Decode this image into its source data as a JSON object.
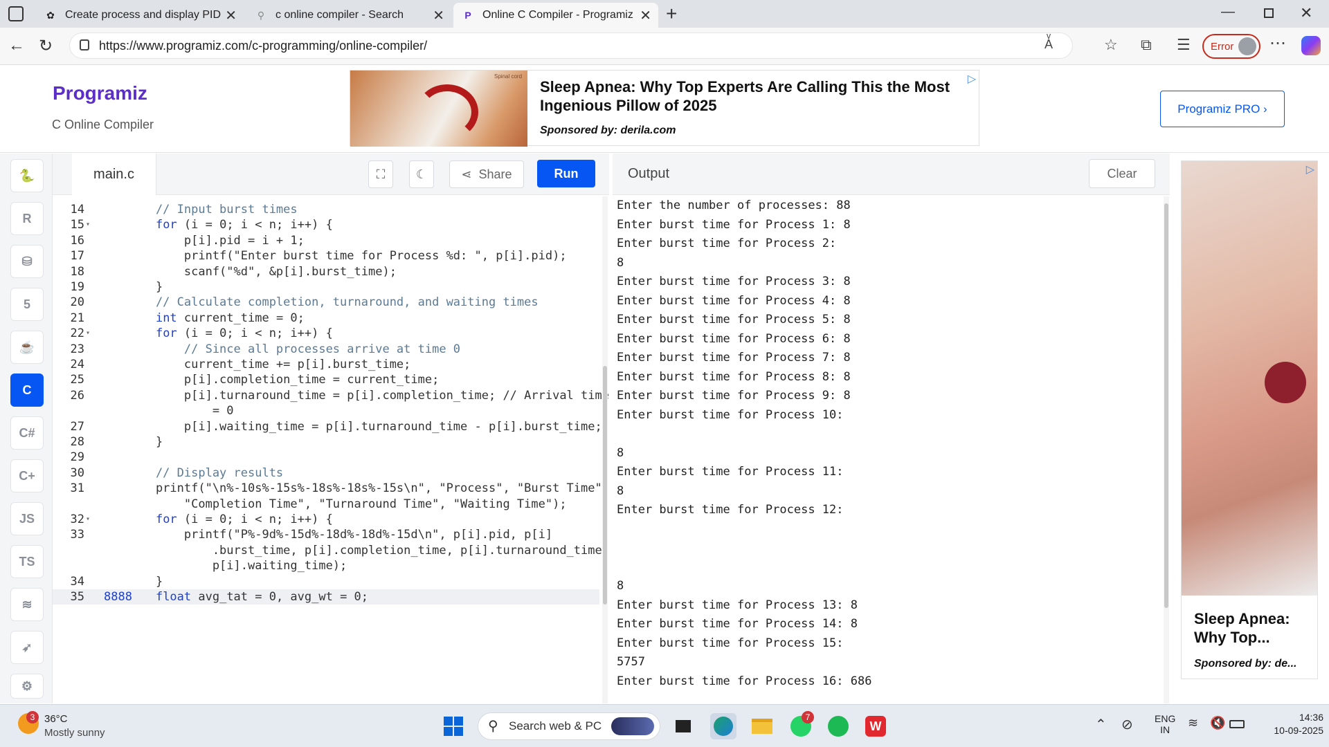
{
  "browser": {
    "tabs": [
      {
        "title": "Create process and display PID",
        "icon": "chatgpt-icon"
      },
      {
        "title": "c online compiler - Search",
        "icon": "search-icon"
      },
      {
        "title": "Online C Compiler - Programiz",
        "icon": "programiz-icon"
      }
    ],
    "url": "https://www.programiz.com/c-programming/online-compiler/",
    "profile_status": "Error"
  },
  "site": {
    "logo": "Programiz",
    "subtitle": "C Online Compiler",
    "pro_button": "Programiz PRO ›",
    "ad": {
      "headline": "Sleep Apnea: Why Top Experts Are Calling This the Most Ingenious Pillow of 2025",
      "sponsor": "Sponsored by: derila.com",
      "image_label": "Spinal cord"
    }
  },
  "language_rail": [
    "python",
    "r",
    "sql",
    "html",
    "java",
    "c",
    "csharp",
    "cpp",
    "js",
    "ts",
    "go",
    "swift",
    "rust"
  ],
  "language_rail_labels": {
    "js": "JS",
    "ts": "TS"
  },
  "editor": {
    "filename": "main.c",
    "share_label": "Share",
    "run_label": "Run",
    "lines": [
      {
        "n": "14",
        "fold": false,
        "text": "    // Input burst times"
      },
      {
        "n": "15",
        "fold": true,
        "text": "    for (i = 0; i < n; i++) {"
      },
      {
        "n": "16",
        "fold": false,
        "text": "        p[i].pid = i + 1;"
      },
      {
        "n": "17",
        "fold": false,
        "text": "        printf(\"Enter burst time for Process %d: \", p[i].pid);"
      },
      {
        "n": "18",
        "fold": false,
        "text": "        scanf(\"%d\", &p[i].burst_time);"
      },
      {
        "n": "19",
        "fold": false,
        "text": "    }"
      },
      {
        "n": "20",
        "fold": false,
        "text": "    // Calculate completion, turnaround, and waiting times"
      },
      {
        "n": "21",
        "fold": false,
        "text": "    int current_time = 0;"
      },
      {
        "n": "22",
        "fold": true,
        "text": "    for (i = 0; i < n; i++) {"
      },
      {
        "n": "23",
        "fold": false,
        "text": "        // Since all processes arrive at time 0"
      },
      {
        "n": "24",
        "fold": false,
        "text": "        current_time += p[i].burst_time;"
      },
      {
        "n": "25",
        "fold": false,
        "text": "        p[i].completion_time = current_time;"
      },
      {
        "n": "26",
        "fold": false,
        "text": "        p[i].turnaround_time = p[i].completion_time; // Arrival time"
      },
      {
        "n": "",
        "fold": false,
        "text": "            = 0"
      },
      {
        "n": "27",
        "fold": false,
        "text": "        p[i].waiting_time = p[i].turnaround_time - p[i].burst_time;"
      },
      {
        "n": "28",
        "fold": false,
        "text": "    }"
      },
      {
        "n": "29",
        "fold": false,
        "text": ""
      },
      {
        "n": "30",
        "fold": false,
        "text": "    // Display results"
      },
      {
        "n": "31",
        "fold": false,
        "text": "    printf(\"\\n%-10s%-15s%-18s%-18s%-15s\\n\", \"Process\", \"Burst Time\","
      },
      {
        "n": "",
        "fold": false,
        "text": "        \"Completion Time\", \"Turnaround Time\", \"Waiting Time\");"
      },
      {
        "n": "32",
        "fold": true,
        "text": "    for (i = 0; i < n; i++) {"
      },
      {
        "n": "33",
        "fold": false,
        "text": "        printf(\"P%-9d%-15d%-18d%-18d%-15d\\n\", p[i].pid, p[i]"
      },
      {
        "n": "",
        "fold": false,
        "text": "            .burst_time, p[i].completion_time, p[i].turnaround_time,"
      },
      {
        "n": "",
        "fold": false,
        "text": "            p[i].waiting_time);"
      },
      {
        "n": "34",
        "fold": false,
        "text": "    }"
      },
      {
        "n": "35",
        "fold": false,
        "text": "8888    float avg_tat = 0, avg_wt = 0;"
      }
    ]
  },
  "output": {
    "title": "Output",
    "clear_label": "Clear",
    "lines": [
      "Enter the number of processes: 88",
      "Enter burst time for Process 1: 8",
      "Enter burst time for Process 2:",
      "8",
      "Enter burst time for Process 3: 8",
      "Enter burst time for Process 4: 8",
      "Enter burst time for Process 5: 8",
      "Enter burst time for Process 6: 8",
      "Enter burst time for Process 7: 8",
      "Enter burst time for Process 8: 8",
      "Enter burst time for Process 9: 8",
      "Enter burst time for Process 10:",
      "",
      "8",
      "Enter burst time for Process 11:",
      "8",
      "Enter burst time for Process 12:",
      "",
      "",
      "",
      "8",
      "Enter burst time for Process 13: 8",
      "Enter burst time for Process 14: 8",
      "Enter burst time for Process 15:",
      "5757",
      "Enter burst time for Process 16: 686"
    ]
  },
  "side_ad": {
    "headline": "Sleep Apnea: Why Top...",
    "sponsor": "Sponsored by: de..."
  },
  "taskbar": {
    "weather_temp": "36°C",
    "weather_desc": "Mostly sunny",
    "weather_badge": "3",
    "search_placeholder": "Search web & PC",
    "whatsapp_badge": "7",
    "lang_line1": "ENG",
    "lang_line2": "IN",
    "time": "14:36",
    "date": "10-09-2025"
  },
  "colors": {
    "accent": "#0556f3",
    "logo": "#5b2ec7"
  }
}
